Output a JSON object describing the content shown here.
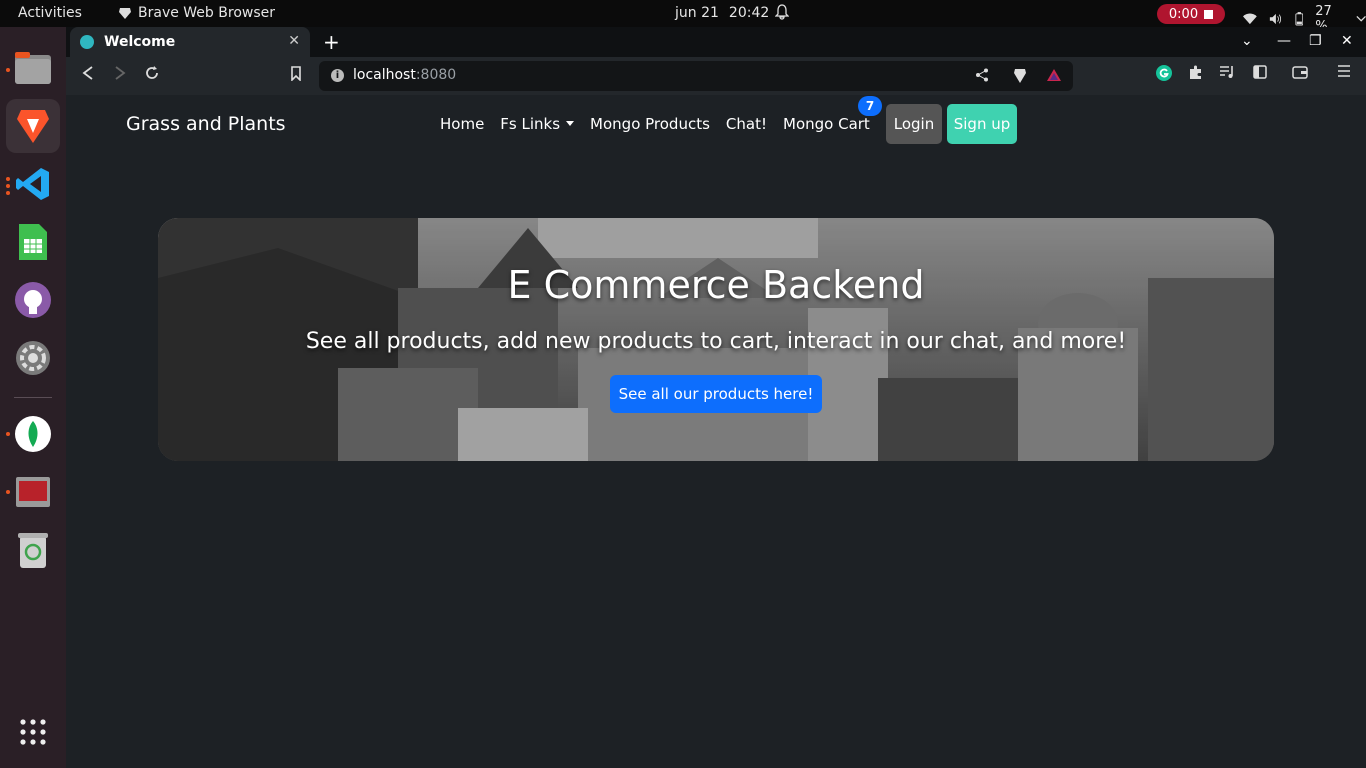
{
  "system": {
    "activities": "Activities",
    "app_name": "Brave Web Browser",
    "date": "jun 21",
    "time": "20:42",
    "recording": "0:00",
    "battery": "27 %"
  },
  "browser": {
    "tab_title": "Welcome",
    "url_host": "localhost",
    "url_port": ":8080"
  },
  "site": {
    "brand": "Grass and Plants",
    "nav": {
      "home": "Home",
      "fs_links": "Fs Links",
      "mongo_products": "Mongo Products",
      "chat": "Chat!",
      "mongo_cart": "Mongo Cart",
      "cart_count": "7",
      "login": "Login",
      "signup": "Sign up"
    },
    "hero": {
      "title": "E Commerce Backend",
      "subtitle": "See all products, add new products to cart, interact in our chat, and more!",
      "cta": "See all our products here!"
    }
  },
  "colors": {
    "primary": "#0d6efd",
    "signup": "#3fd2b0",
    "page_bg": "#1d2125"
  }
}
